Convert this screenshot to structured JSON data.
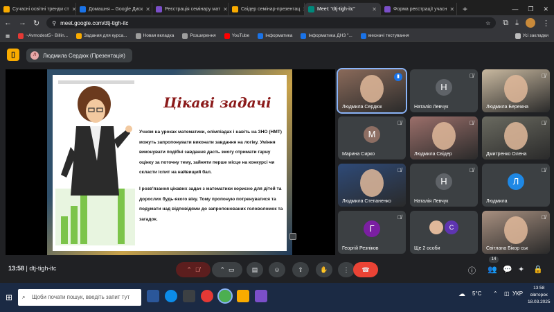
{
  "tabs": [
    {
      "label": "Сучасні освітні тренди ст",
      "color": "#f9ab00"
    },
    {
      "label": "Домашня – Google Диск",
      "color": "#1a73e8"
    },
    {
      "label": "Реєстрація семінару мат",
      "color": "#7b4fc9"
    },
    {
      "label": "Свідер семінар-презентац",
      "color": "#f9ab00"
    },
    {
      "label": "Meet: \"dtj-tigh-itc\"",
      "color": "#00897b"
    },
    {
      "label": "Форма реєстрації учасн",
      "color": "#7b4fc9"
    }
  ],
  "address": {
    "url": "meet.google.com/dtj-tigh-itc"
  },
  "bookmarks": [
    {
      "label": "~Avmodest5~ Billin...",
      "color": "#e53935"
    },
    {
      "label": "Задания для курса...",
      "color": "#f9ab00"
    },
    {
      "label": "Новая вкладка",
      "color": "#9e9e9e"
    },
    {
      "label": "Розширення",
      "color": "#9e9e9e"
    },
    {
      "label": "YouTube",
      "color": "#ff0000"
    },
    {
      "label": "Інформатика",
      "color": "#1a73e8"
    },
    {
      "label": "Інформатика ДНЗ \"...",
      "color": "#1a73e8"
    },
    {
      "label": "месначі тестування",
      "color": "#1a73e8"
    }
  ],
  "bookmarks_all": "Усі закладки",
  "presenter": {
    "initial": "Л",
    "label": "Людмила Сердюк (Презентація)"
  },
  "slide": {
    "title": "Цікаві задачі",
    "para1": "Учням на уроках математики, олімпіадах і навіть на ЗНО (НМТ) можуть запропонувати виконати завдання на логіку. Уміння виконувати подібні завдання дасть змогу отримати гарну оцінку за поточну тему, зайняти перше місце на конкурсі чи скласти іспит на найвищий бал.",
    "para2": "І розв'язання цікавих задач з математики корисно для дітей та дорослих будь-якого віку. Тому пропоную потренуватися та подумати над відповідями до запропонованих головоломок та загадок."
  },
  "participants": [
    {
      "name": "Людмила Сердюк",
      "type": "photo",
      "color": "#8a6a5a",
      "speaking": true
    },
    {
      "name": "Наталія Левчук",
      "type": "avatar",
      "initial": "Н",
      "color": "#5f6368"
    },
    {
      "name": "Людмила Бережна",
      "type": "photo",
      "color": "#c9b9a0"
    },
    {
      "name": "Марина Сирко",
      "type": "avatar",
      "initial": "М",
      "color": "#8d6e63"
    },
    {
      "name": "Людмила Свідер",
      "type": "photo",
      "color": "#9b6f6a"
    },
    {
      "name": "Дмитренко Олена",
      "type": "photo",
      "color": "#6a6a60"
    },
    {
      "name": "Людмила Степаненко",
      "type": "photo",
      "color": "#2e4a78"
    },
    {
      "name": "Наталія Левчук",
      "type": "avatar",
      "initial": "Н",
      "color": "#5f6368"
    },
    {
      "name": "Людмила",
      "type": "avatar",
      "initial": "Л",
      "color": "#1e88e5"
    },
    {
      "name": "Георгій Резніков",
      "type": "avatar",
      "initial": "Г",
      "color": "#7b1fa2"
    },
    {
      "name": "Ще 2 особи",
      "type": "group",
      "initial": "С",
      "color": "#5e35b1"
    },
    {
      "name": "Світлана Бікор ськ",
      "type": "photo",
      "color": "#a89080"
    }
  ],
  "controls": {
    "time": "13:58",
    "meeting_code": "dtj-tigh-itc",
    "people_count": "14"
  },
  "taskbar": {
    "search_placeholder": "Щоби почати пошук, введіть запит тут",
    "weather": "5°C",
    "lang": "УКР",
    "time": "13:58",
    "day": "вівторок",
    "date": "18.03.2025"
  }
}
